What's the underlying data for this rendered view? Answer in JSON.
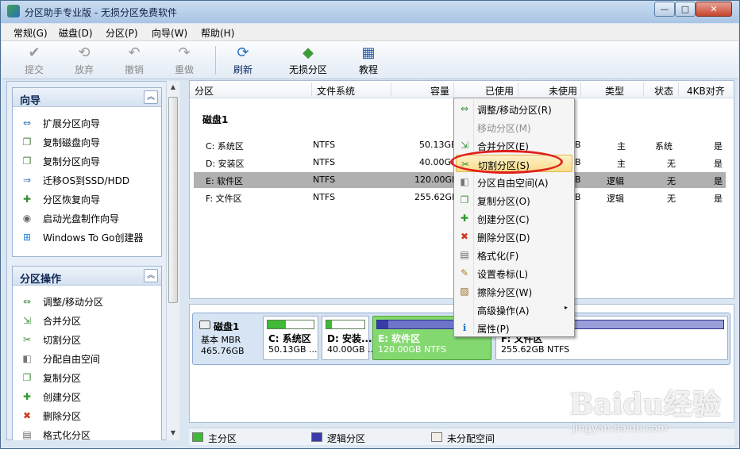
{
  "window": {
    "title": "分区助手专业版 - 无损分区免费软件",
    "min": "—",
    "max": "□",
    "close": "✕"
  },
  "menubar": [
    "常规(G)",
    "磁盘(D)",
    "分区(P)",
    "向导(W)",
    "帮助(H)"
  ],
  "toolbar": [
    {
      "label": "提交",
      "icon": "✔",
      "disabled": true
    },
    {
      "label": "放弃",
      "icon": "⟲",
      "disabled": true
    },
    {
      "label": "撤销",
      "icon": "↶",
      "disabled": true
    },
    {
      "label": "重做",
      "icon": "↷",
      "disabled": true
    },
    {
      "label": "刷新",
      "icon": "⟳",
      "disabled": false
    },
    {
      "label": "无损分区",
      "icon": "◆",
      "disabled": false
    },
    {
      "label": "教程",
      "icon": "▦",
      "disabled": false
    }
  ],
  "wizard_section": {
    "title": "向导",
    "items": [
      "扩展分区向导",
      "复制磁盘向导",
      "复制分区向导",
      "迁移OS到SSD/HDD",
      "分区恢复向导",
      "启动光盘制作向导",
      "Windows To Go创建器"
    ]
  },
  "ops_section": {
    "title": "分区操作",
    "items": [
      "调整/移动分区",
      "合并分区",
      "切割分区",
      "分配自由空间",
      "复制分区",
      "创建分区",
      "删除分区",
      "格式化分区"
    ]
  },
  "table": {
    "columns": [
      "分区",
      "文件系统",
      "容量",
      "已使用",
      "未使用",
      "类型",
      "状态",
      "4KB对齐"
    ],
    "disk_label": "磁盘1",
    "rows": [
      {
        "name": "C: 系统区",
        "fs": "NTFS",
        "cap": "50.13GB",
        "unused": "B",
        "type": "主",
        "status": "系统",
        "align": "是"
      },
      {
        "name": "D: 安装区",
        "fs": "NTFS",
        "cap": "40.00GB",
        "unused": "B",
        "type": "主",
        "status": "无",
        "align": "是"
      },
      {
        "name": "E: 软件区",
        "fs": "NTFS",
        "cap": "120.00GB",
        "unused": "B",
        "type": "逻辑",
        "status": "无",
        "align": "是"
      },
      {
        "name": "F: 文件区",
        "fs": "NTFS",
        "cap": "255.62GB",
        "unused": "B",
        "type": "逻辑",
        "status": "无",
        "align": "是"
      }
    ]
  },
  "context_menu": [
    {
      "label": "调整/移动分区(R)",
      "icon": "⇔",
      "disabled": false
    },
    {
      "label": "移动分区(M)",
      "icon": "",
      "disabled": true
    },
    {
      "label": "合并分区(E)",
      "icon": "⇲",
      "disabled": false
    },
    {
      "label": "切割分区(S)",
      "icon": "✂",
      "disabled": false,
      "highlight": true
    },
    {
      "label": "分区自由空间(A)",
      "icon": "◧",
      "disabled": false
    },
    {
      "label": "复制分区(O)",
      "icon": "❐",
      "disabled": false
    },
    {
      "label": "创建分区(C)",
      "icon": "✚",
      "disabled": false
    },
    {
      "label": "删除分区(D)",
      "icon": "✖",
      "disabled": false
    },
    {
      "label": "格式化(F)",
      "icon": "▤",
      "disabled": false
    },
    {
      "label": "设置卷标(L)",
      "icon": "✎",
      "disabled": false
    },
    {
      "label": "擦除分区(W)",
      "icon": "▨",
      "disabled": false
    },
    {
      "label": "高级操作(A)",
      "icon": "",
      "disabled": false,
      "submenu": "▸"
    },
    {
      "label": "属性(P)",
      "icon": "ℹ",
      "disabled": false
    }
  ],
  "diskmap": {
    "disk_name": "磁盘1",
    "disk_type": "基本 MBR",
    "disk_size": "465.76GB",
    "partitions": [
      {
        "name": "C: 系统区",
        "size": "50.13GB ...",
        "fill": 0.4
      },
      {
        "name": "D: 安装...",
        "size": "40.00GB ...",
        "fill": 0.15
      },
      {
        "name": "E: 软件区",
        "size": "120.00GB NTFS",
        "fill": 0.1
      },
      {
        "name": "F: 文件区",
        "size": "255.62GB NTFS",
        "fill": 0.25
      }
    ]
  },
  "legend": [
    "主分区",
    "逻辑分区",
    "未分配空间"
  ],
  "colors": {
    "primary": "#3fb936",
    "logical": "#3a3aa8",
    "unallocated": "#f3efe6"
  },
  "watermark": {
    "main": "Baidu经验",
    "sub": "jingyan.baidu.com"
  }
}
